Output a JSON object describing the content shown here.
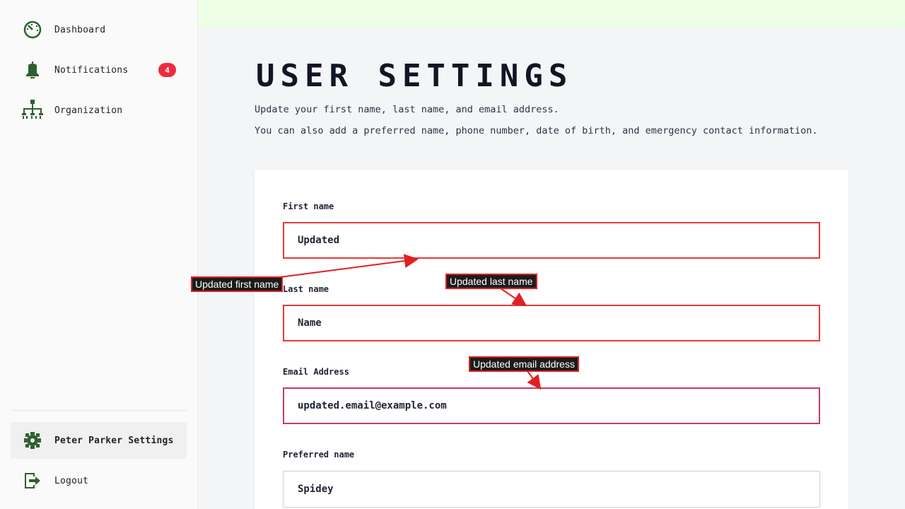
{
  "sidebar": {
    "items": [
      {
        "label": "Dashboard",
        "icon": "dashboard-icon"
      },
      {
        "label": "Notifications",
        "icon": "bell-icon",
        "badge": "4"
      },
      {
        "label": "Organization",
        "icon": "org-chart-icon"
      }
    ],
    "bottom_items": [
      {
        "label": "Peter Parker Settings",
        "icon": "gear-icon",
        "active": true
      },
      {
        "label": "Logout",
        "icon": "logout-icon"
      }
    ]
  },
  "main": {
    "title": "USER SETTINGS",
    "subtitle_1": "Update your first name, last name, and email address.",
    "subtitle_2": "You can also add a preferred name, phone number, date of birth, and emergency contact information.",
    "fields": {
      "first_name": {
        "label": "First name",
        "value": "Updated"
      },
      "last_name": {
        "label": "Last name",
        "value": "Name"
      },
      "email": {
        "label": "Email Address",
        "value": "updated.email@example.com"
      },
      "preferred_name": {
        "label": "Preferred name",
        "value": "Spidey"
      }
    }
  },
  "annotations": {
    "first_name": "Updated first name",
    "last_name": "Updated last name",
    "email": "Updated email address"
  },
  "colors": {
    "accent_green": "#2f5f2f",
    "badge_red": "#ee2b3c",
    "annotation_red": "#e02020",
    "banner_green": "#ecffe6"
  }
}
